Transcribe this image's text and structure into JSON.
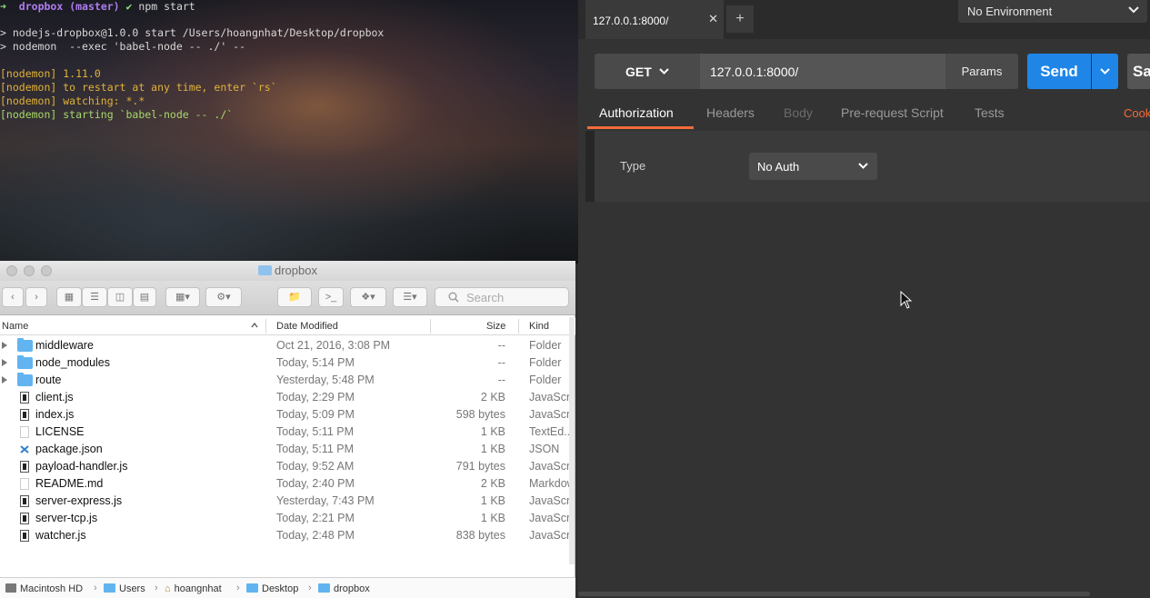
{
  "terminal": {
    "prompt_arrow": "➜",
    "prompt_dir": "dropbox",
    "prompt_branch": "(master)",
    "prompt_check": "✔",
    "prompt_cmd": "npm start",
    "lines": [
      "> nodejs-dropbox@1.0.0 start /Users/hoangnhat/Desktop/dropbox",
      "> nodemon  --exec 'babel-node -- ./' --",
      "[nodemon] 1.11.0",
      "[nodemon] to restart at any time, enter `rs`",
      "[nodemon] watching: *.*",
      "[nodemon] starting `babel-node -- ./`"
    ]
  },
  "postman": {
    "tab_label": "127.0.0.1:8000/",
    "tab_close": "✕",
    "tab_add": "+",
    "environment": "No Environment",
    "method": "GET",
    "url": "127.0.0.1:8000/",
    "params_label": "Params",
    "send_label": "Send",
    "save_label": "Sa",
    "subtabs": [
      "Authorization",
      "Headers",
      "Body",
      "Pre-request Script",
      "Tests"
    ],
    "cookies_label": "Cook",
    "type_label": "Type",
    "auth_value": "No Auth",
    "colors": {
      "accent": "#f26b3a",
      "send": "#1f86e8"
    }
  },
  "finder": {
    "title": "dropbox",
    "search_placeholder": "Search",
    "columns": {
      "name": "Name",
      "date": "Date Modified",
      "size": "Size",
      "kind": "Kind"
    },
    "rows": [
      {
        "name": "middleware",
        "date": "Oct 21, 2016, 3:08 PM",
        "size": "--",
        "kind": "Folder",
        "type": "folder"
      },
      {
        "name": "node_modules",
        "date": "Today, 5:14 PM",
        "size": "--",
        "kind": "Folder",
        "type": "folder"
      },
      {
        "name": "route",
        "date": "Yesterday, 5:48 PM",
        "size": "--",
        "kind": "Folder",
        "type": "folder"
      },
      {
        "name": "client.js",
        "date": "Today, 2:29 PM",
        "size": "2 KB",
        "kind": "JavaScript",
        "type": "js"
      },
      {
        "name": "index.js",
        "date": "Today, 5:09 PM",
        "size": "598 bytes",
        "kind": "JavaScript",
        "type": "js"
      },
      {
        "name": "LICENSE",
        "date": "Today, 5:11 PM",
        "size": "1 KB",
        "kind": "TextEd...ument",
        "type": "txt"
      },
      {
        "name": "package.json",
        "date": "Today, 5:11 PM",
        "size": "1 KB",
        "kind": "JSON",
        "type": "json"
      },
      {
        "name": "payload-handler.js",
        "date": "Today, 9:52 AM",
        "size": "791 bytes",
        "kind": "JavaScript",
        "type": "js"
      },
      {
        "name": "README.md",
        "date": "Today, 2:40 PM",
        "size": "2 KB",
        "kind": "Markdown",
        "type": "txt"
      },
      {
        "name": "server-express.js",
        "date": "Yesterday, 7:43 PM",
        "size": "1 KB",
        "kind": "JavaScript",
        "type": "js"
      },
      {
        "name": "server-tcp.js",
        "date": "Today, 2:21 PM",
        "size": "1 KB",
        "kind": "JavaScript",
        "type": "js"
      },
      {
        "name": "watcher.js",
        "date": "Today, 2:48 PM",
        "size": "838 bytes",
        "kind": "JavaScript",
        "type": "js"
      }
    ],
    "path": [
      "Macintosh HD",
      "Users",
      "hoangnhat",
      "Desktop",
      "dropbox"
    ]
  }
}
